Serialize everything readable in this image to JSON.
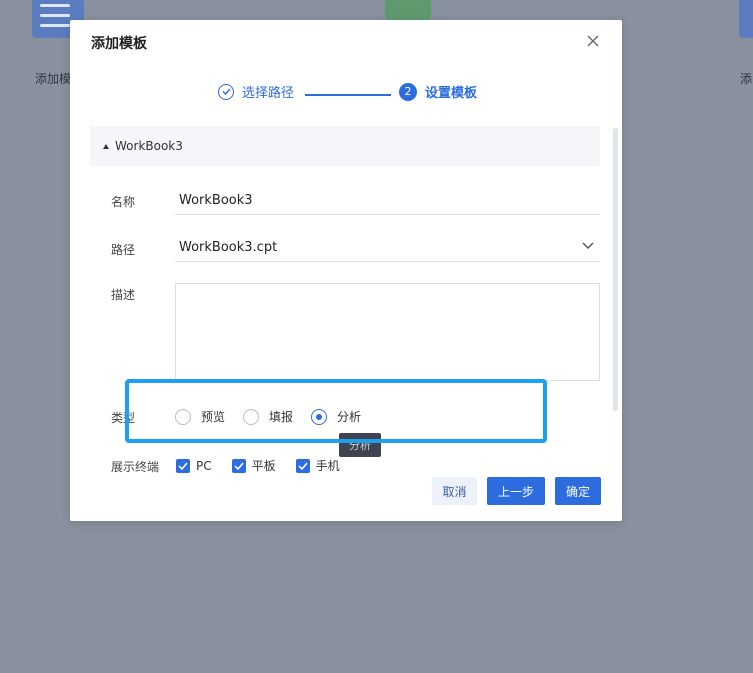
{
  "background": {
    "left_tile_label": "添加模",
    "right_tile_label": "添"
  },
  "dialog": {
    "title": "添加模板",
    "close_icon": "close-icon",
    "steps": [
      {
        "label": "选择路径",
        "state": "done"
      },
      {
        "number": "2",
        "label": "设置模板",
        "state": "current"
      }
    ],
    "section_title": "WorkBook3",
    "fields": {
      "name_label": "名称",
      "name_value": "WorkBook3",
      "path_label": "路径",
      "path_value": "WorkBook3.cpt",
      "desc_label": "描述",
      "desc_value": "",
      "type_label": "类型",
      "type_options": [
        {
          "label": "预览",
          "checked": false
        },
        {
          "label": "填报",
          "checked": false
        },
        {
          "label": "分析",
          "checked": true
        }
      ],
      "terminal_label": "展示终端",
      "terminal_options": [
        {
          "label": "PC",
          "checked": true
        },
        {
          "label": "平板",
          "checked": true
        },
        {
          "label": "手机",
          "checked": true
        }
      ]
    },
    "tooltip": "分析",
    "buttons": {
      "cancel": "取消",
      "prev": "上一步",
      "ok": "确定"
    }
  },
  "colors": {
    "accent": "#2d6cdf",
    "highlight": "#1ea0f0",
    "overlay": "#8a919e"
  }
}
